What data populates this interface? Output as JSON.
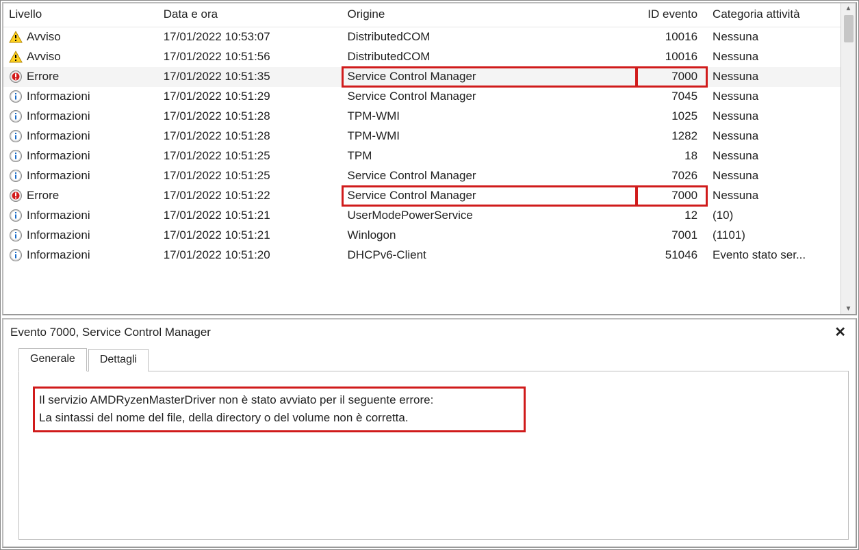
{
  "columns": {
    "level": "Livello",
    "date": "Data e ora",
    "source": "Origine",
    "id": "ID evento",
    "cat": "Categoria attività"
  },
  "level_labels": {
    "warning": "Avviso",
    "error": "Errore",
    "info": "Informazioni"
  },
  "rows": [
    {
      "level": "warning",
      "date": "17/01/2022 10:53:07",
      "source": "DistributedCOM",
      "id": "10016",
      "cat": "Nessuna",
      "selected": false,
      "highlight": false
    },
    {
      "level": "warning",
      "date": "17/01/2022 10:51:56",
      "source": "DistributedCOM",
      "id": "10016",
      "cat": "Nessuna",
      "selected": false,
      "highlight": false
    },
    {
      "level": "error",
      "date": "17/01/2022 10:51:35",
      "source": "Service Control Manager",
      "id": "7000",
      "cat": "Nessuna",
      "selected": true,
      "highlight": true
    },
    {
      "level": "info",
      "date": "17/01/2022 10:51:29",
      "source": "Service Control Manager",
      "id": "7045",
      "cat": "Nessuna",
      "selected": false,
      "highlight": false
    },
    {
      "level": "info",
      "date": "17/01/2022 10:51:28",
      "source": "TPM-WMI",
      "id": "1025",
      "cat": "Nessuna",
      "selected": false,
      "highlight": false
    },
    {
      "level": "info",
      "date": "17/01/2022 10:51:28",
      "source": "TPM-WMI",
      "id": "1282",
      "cat": "Nessuna",
      "selected": false,
      "highlight": false
    },
    {
      "level": "info",
      "date": "17/01/2022 10:51:25",
      "source": "TPM",
      "id": "18",
      "cat": "Nessuna",
      "selected": false,
      "highlight": false
    },
    {
      "level": "info",
      "date": "17/01/2022 10:51:25",
      "source": "Service Control Manager",
      "id": "7026",
      "cat": "Nessuna",
      "selected": false,
      "highlight": false
    },
    {
      "level": "error",
      "date": "17/01/2022 10:51:22",
      "source": "Service Control Manager",
      "id": "7000",
      "cat": "Nessuna",
      "selected": false,
      "highlight": true
    },
    {
      "level": "info",
      "date": "17/01/2022 10:51:21",
      "source": "UserModePowerService",
      "id": "12",
      "cat": "(10)",
      "selected": false,
      "highlight": false
    },
    {
      "level": "info",
      "date": "17/01/2022 10:51:21",
      "source": "Winlogon",
      "id": "7001",
      "cat": "(1101)",
      "selected": false,
      "highlight": false
    },
    {
      "level": "info",
      "date": "17/01/2022 10:51:20",
      "source": "DHCPv6-Client",
      "id": "51046",
      "cat": "Evento stato ser...",
      "selected": false,
      "highlight": false
    }
  ],
  "detail": {
    "title": "Evento 7000, Service Control Manager",
    "tabs": {
      "general": "Generale",
      "details": "Dettagli"
    },
    "message_line1": "Il servizio AMDRyzenMasterDriver non è stato avviato per il seguente errore:",
    "message_line2": "La sintassi del nome del file, della directory o del volume non è corretta."
  },
  "icons": {
    "warning": "warning-icon",
    "error": "error-icon",
    "info": "info-icon"
  }
}
